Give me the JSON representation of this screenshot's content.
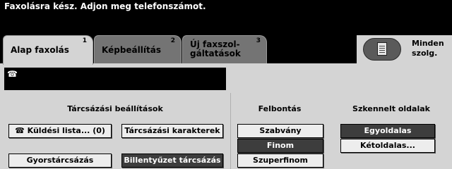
{
  "status_message": "Faxolásra kész. Adjon meg telefonszámot.",
  "tabs": [
    {
      "label": "Alap faxolás",
      "number": "1",
      "active": true
    },
    {
      "label": "Képbeállítás",
      "number": "2",
      "active": false
    },
    {
      "label_line1": "Új faxszol-",
      "label_line2": "gáltatások",
      "number": "3",
      "active": false
    }
  ],
  "services": {
    "label_line1": "Minden",
    "label_line2": "szolg.",
    "icon": "clipboard-icon"
  },
  "fax_number": {
    "icon": "phone-icon",
    "glyph": "☎",
    "value": ""
  },
  "dialing": {
    "title": "Tárcsázási beállítások",
    "send_list_icon": "☎",
    "send_list_label": "Küldési lista... (0)",
    "dial_chars_label": "Tárcsázási karakterek",
    "speed_dial_label": "Gyorstárcsázás",
    "keyboard_dial_label": "Billentyűzet tárcsázás"
  },
  "resolution": {
    "title": "Felbontás",
    "options": [
      "Szabvány",
      "Finom",
      "Szuperfinom"
    ],
    "selected": "Finom"
  },
  "scanned_sides": {
    "title": "Szkennelt oldalak",
    "options": [
      "Egyoldalas",
      "Kétoldalas..."
    ],
    "selected": "Egyoldalas"
  },
  "colors": {
    "selected_button": "#3d3d3d",
    "panel": "#d4d4d4",
    "inactive_tab": "#747474"
  }
}
